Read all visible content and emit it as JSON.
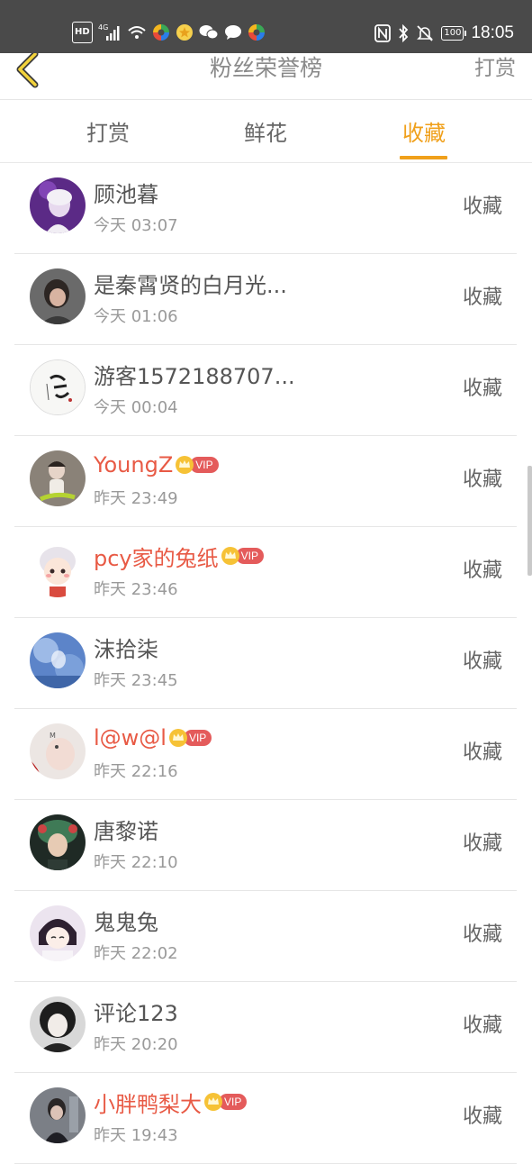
{
  "status_bar": {
    "hd": "HD",
    "network": "4G",
    "nfc": "N",
    "battery": "100",
    "time": "18:05"
  },
  "header": {
    "title": "粉丝荣誉榜",
    "action": "打赏",
    "back_icon": "chevron-left-icon"
  },
  "tabs": [
    {
      "label": "打赏",
      "active": false
    },
    {
      "label": "鲜花",
      "active": false
    },
    {
      "label": "收藏",
      "active": true
    }
  ],
  "colors": {
    "accent": "#f0a01b",
    "vip_name": "#e85a45",
    "status_bar": "#4a4a4a"
  },
  "list": [
    {
      "name": "顾池暮",
      "time": "今天 03:07",
      "action": "收藏",
      "vip": false
    },
    {
      "name": "是秦霄贤的白月光...",
      "time": "今天 01:06",
      "action": "收藏",
      "vip": false
    },
    {
      "name": "游客1572188707...",
      "time": "今天 00:04",
      "action": "收藏",
      "vip": false
    },
    {
      "name": "YoungZ",
      "time": "昨天 23:49",
      "action": "收藏",
      "vip": true,
      "vip_label": "VIP"
    },
    {
      "name": "pcy家的兔纸",
      "time": "昨天 23:46",
      "action": "收藏",
      "vip": true,
      "vip_label": "VIP"
    },
    {
      "name": "沫拾柒",
      "time": "昨天 23:45",
      "action": "收藏",
      "vip": false
    },
    {
      "name": "l@w@l",
      "time": "昨天 22:16",
      "action": "收藏",
      "vip": true,
      "vip_label": "VIP"
    },
    {
      "name": "唐黎诺",
      "time": "昨天 22:10",
      "action": "收藏",
      "vip": false
    },
    {
      "name": "鬼鬼兔",
      "time": "昨天 22:02",
      "action": "收藏",
      "vip": false
    },
    {
      "name": "评论123",
      "time": "昨天 20:20",
      "action": "收藏",
      "vip": false
    },
    {
      "name": "小胖鸭梨大",
      "time": "昨天 19:43",
      "action": "收藏",
      "vip": true,
      "vip_label": "VIP"
    }
  ]
}
